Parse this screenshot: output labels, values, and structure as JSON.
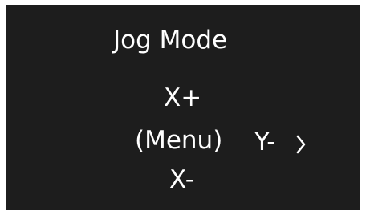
{
  "screen": {
    "title": "Jog Mode",
    "up_label": "X+",
    "center_label": "(Menu)",
    "right_label": "Y-",
    "down_label": "X-",
    "right_arrow_icon": "chevron-right-icon",
    "background_color": "#1d1d1d",
    "text_color": "#ffffff"
  }
}
